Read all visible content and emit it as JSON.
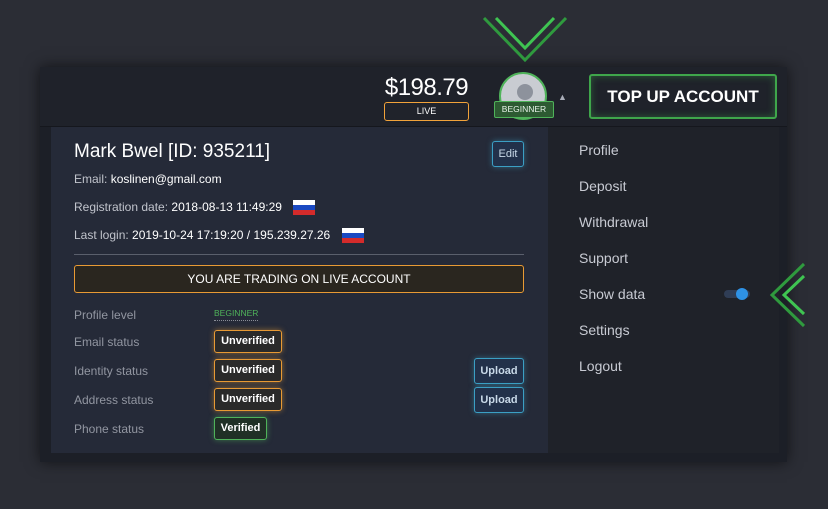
{
  "header": {
    "balance": "$198.79",
    "account_type": "LIVE",
    "level_badge": "BEGINNER",
    "topup_label": "TOP UP ACCOUNT"
  },
  "profile": {
    "name": "Mark Bwel [ID: 935211]",
    "edit_label": "Edit",
    "email_label": "Email:",
    "email": "koslinen@gmail.com",
    "reg_label": "Registration date:",
    "reg_date": "2018-08-13 11:49:29",
    "login_label": "Last login:",
    "last_login": "2019-10-24 17:19:20 / 195.239.27.26",
    "live_banner": "YOU ARE TRADING ON LIVE ACCOUNT",
    "rows": [
      {
        "label": "Profile level",
        "value": "BEGINNER"
      },
      {
        "label": "Email status",
        "value": "Unverified"
      },
      {
        "label": "Identity status",
        "value": "Unverified",
        "action": "Upload"
      },
      {
        "label": "Address status",
        "value": "Unverified",
        "action": "Upload"
      },
      {
        "label": "Phone status",
        "value": "Verified"
      }
    ]
  },
  "menu": {
    "items": [
      "Profile",
      "Deposit",
      "Withdrawal",
      "Support",
      "Show data",
      "Settings",
      "Logout"
    ],
    "show_data_enabled": true
  },
  "colors": {
    "accent_green": "#3fa64b",
    "accent_orange": "#e89a34",
    "accent_blue": "#2e92e6"
  },
  "icons": {
    "arrow_top": "chevron-down-icon",
    "arrow_right": "chevron-left-icon",
    "flag": "russia-flag-icon"
  }
}
